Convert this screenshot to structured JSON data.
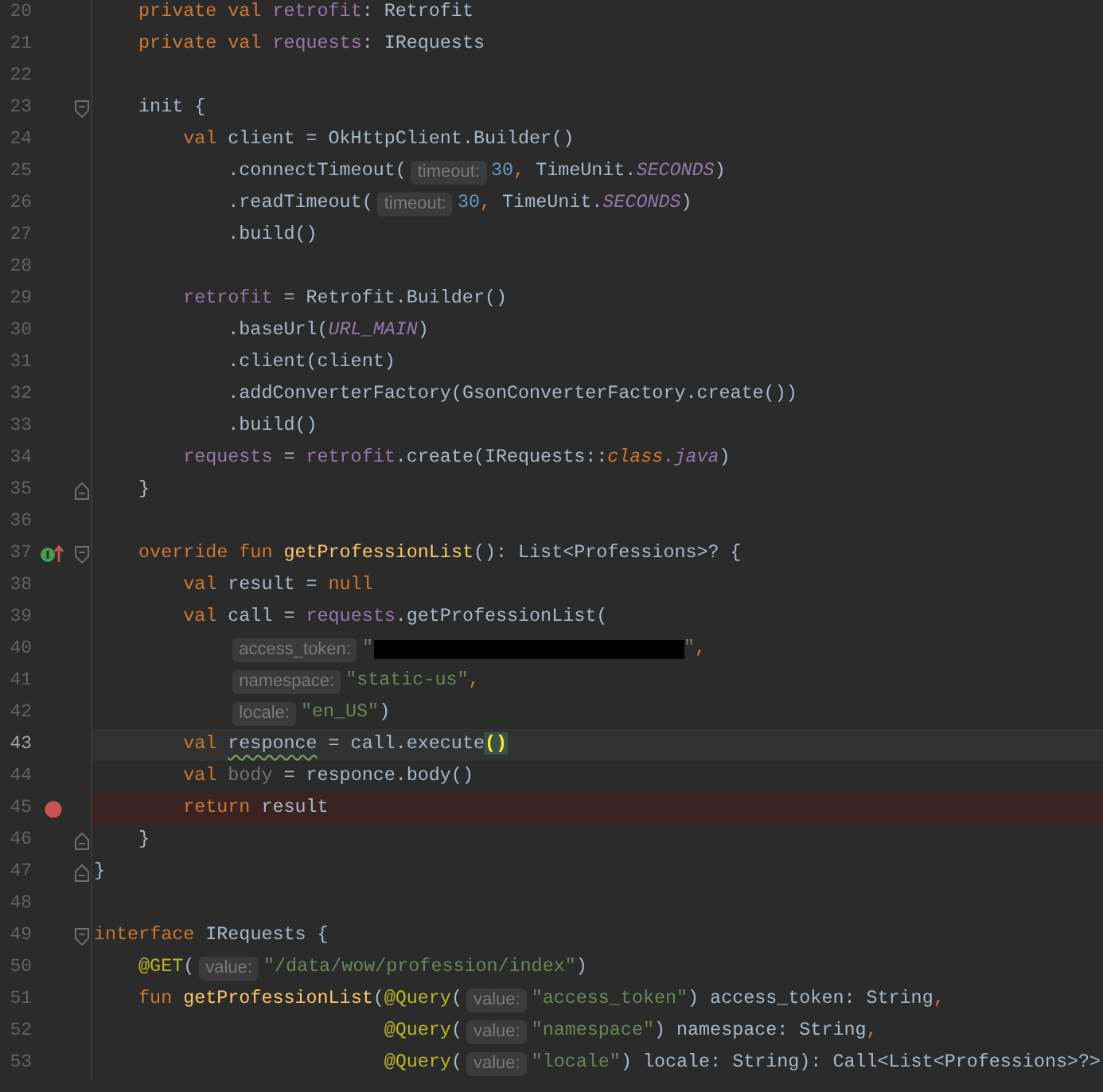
{
  "editor": {
    "class_body": [
      {
        "number": "20",
        "kind": "plain",
        "current": false,
        "breakpoint": false,
        "tokens": [
          {
            "text": "private val ",
            "kind": "kw"
          },
          {
            "text": "retrofit",
            "kind": "field"
          },
          {
            "text": ": Retrofit",
            "kind": "plain"
          }
        ]
      },
      {
        "number": "21",
        "kind": "plain",
        "current": false,
        "breakpoint": false,
        "tokens": [
          {
            "text": "private val ",
            "kind": "kw"
          },
          {
            "text": "requests",
            "kind": "field"
          },
          {
            "text": ": IRequests",
            "kind": "plain"
          }
        ]
      },
      {
        "number": "22",
        "kind": "plain",
        "current": false,
        "breakpoint": false
      },
      {
        "number": "23",
        "kind": "fold-start",
        "current": false,
        "breakpoint": false,
        "tokens": [
          {
            "text": "init {",
            "kind": "plain"
          }
        ],
        "children": [
          {
            "number": "24",
            "kind": "plain",
            "current": false,
            "breakpoint": false,
            "tokens": [
              {
                "text": "val ",
                "kind": "kw"
              },
              {
                "text": "client = OkHttpClient.Builder()",
                "kind": "plain"
              }
            ],
            "children": [
              {
                "number": "25",
                "kind": "plain",
                "current": false,
                "breakpoint": false,
                "tokens": [
                  {
                    "text": ".connectTimeout(",
                    "kind": "plain"
                  },
                  {
                    "text": "timeout:",
                    "kind": "hint"
                  },
                  {
                    "text": "30",
                    "kind": "num"
                  },
                  {
                    "text": ",",
                    "kind": "comma"
                  },
                  {
                    "text": " TimeUnit.",
                    "kind": "plain"
                  },
                  {
                    "text": "SECONDS",
                    "kind": "const"
                  },
                  {
                    "text": ")",
                    "kind": "plain"
                  }
                ]
              },
              {
                "number": "26",
                "kind": "plain",
                "current": false,
                "breakpoint": false,
                "tokens": [
                  {
                    "text": ".readTimeout(",
                    "kind": "plain"
                  },
                  {
                    "text": "timeout:",
                    "kind": "hint"
                  },
                  {
                    "text": "30",
                    "kind": "num"
                  },
                  {
                    "text": ",",
                    "kind": "comma"
                  },
                  {
                    "text": " TimeUnit.",
                    "kind": "plain"
                  },
                  {
                    "text": "SECONDS",
                    "kind": "const"
                  },
                  {
                    "text": ")",
                    "kind": "plain"
                  }
                ]
              },
              {
                "number": "27",
                "kind": "plain",
                "current": false,
                "breakpoint": false,
                "tokens": [
                  {
                    "text": ".build()",
                    "kind": "plain"
                  }
                ]
              }
            ]
          },
          {
            "number": "28",
            "kind": "plain",
            "current": false,
            "breakpoint": false
          },
          {
            "number": "29",
            "kind": "plain",
            "current": false,
            "breakpoint": false,
            "tokens": [
              {
                "text": "retrofit",
                "kind": "field"
              },
              {
                "text": " = Retrofit.Builder()",
                "kind": "plain"
              }
            ],
            "children": [
              {
                "number": "30",
                "kind": "plain",
                "current": false,
                "breakpoint": false,
                "tokens": [
                  {
                    "text": ".baseUrl(",
                    "kind": "plain"
                  },
                  {
                    "text": "URL_MAIN",
                    "kind": "const"
                  },
                  {
                    "text": ")",
                    "kind": "plain"
                  }
                ]
              },
              {
                "number": "31",
                "kind": "plain",
                "current": false,
                "breakpoint": false,
                "tokens": [
                  {
                    "text": ".client(client)",
                    "kind": "plain"
                  }
                ]
              },
              {
                "number": "32",
                "kind": "plain",
                "current": false,
                "breakpoint": false,
                "tokens": [
                  {
                    "text": ".addConverterFactory(GsonConverterFactory.create())",
                    "kind": "plain"
                  }
                ]
              },
              {
                "number": "33",
                "kind": "plain",
                "current": false,
                "breakpoint": false,
                "tokens": [
                  {
                    "text": ".build()",
                    "kind": "plain"
                  }
                ]
              }
            ]
          },
          {
            "number": "34",
            "kind": "plain",
            "current": false,
            "breakpoint": false,
            "tokens": [
              {
                "text": "requests",
                "kind": "field"
              },
              {
                "text": " = ",
                "kind": "plain"
              },
              {
                "text": "retrofit",
                "kind": "field"
              },
              {
                "text": ".create(IRequests::",
                "kind": "plain"
              },
              {
                "text": "class",
                "kind": "kwi"
              },
              {
                "text": ".java",
                "kind": "const"
              },
              {
                "text": ")",
                "kind": "plain"
              }
            ]
          }
        ]
      },
      {
        "number": "35",
        "kind": "fold-end",
        "current": false,
        "breakpoint": false,
        "tokens": [
          {
            "text": "}",
            "kind": "plain"
          }
        ]
      },
      {
        "number": "36",
        "kind": "plain",
        "current": false,
        "breakpoint": false
      },
      {
        "number": "37",
        "kind": "implements-fold-start",
        "current": false,
        "breakpoint": false,
        "tokens": [
          {
            "text": "override fun ",
            "kind": "kw"
          },
          {
            "text": "getProfessionList",
            "kind": "fn"
          },
          {
            "text": "(): List<Professions>? {",
            "kind": "plain"
          }
        ],
        "children": [
          {
            "number": "38",
            "kind": "plain",
            "current": false,
            "breakpoint": false,
            "tokens": [
              {
                "text": "val ",
                "kind": "kw"
              },
              {
                "text": "result = ",
                "kind": "plain"
              },
              {
                "text": "null",
                "kind": "kw"
              }
            ]
          },
          {
            "number": "39",
            "kind": "plain",
            "current": false,
            "breakpoint": false,
            "tokens": [
              {
                "text": "val ",
                "kind": "kw"
              },
              {
                "text": "call = ",
                "kind": "plain"
              },
              {
                "text": "requests",
                "kind": "field"
              },
              {
                "text": ".getProfessionList(",
                "kind": "plain"
              }
            ],
            "children": [
              {
                "number": "40",
                "kind": "plain",
                "current": false,
                "breakpoint": false,
                "tokens": [
                  {
                    "text": "access_token:",
                    "kind": "hint"
                  },
                  {
                    "text": "\"",
                    "kind": "str"
                  },
                  {
                    "kind": "redacted"
                  },
                  {
                    "text": "\"",
                    "kind": "str"
                  },
                  {
                    "text": ",",
                    "kind": "comma"
                  }
                ]
              },
              {
                "number": "41",
                "kind": "plain",
                "current": false,
                "breakpoint": false,
                "tokens": [
                  {
                    "text": "namespace:",
                    "kind": "hint"
                  },
                  {
                    "text": "\"static-us\"",
                    "kind": "str"
                  },
                  {
                    "text": ",",
                    "kind": "comma"
                  }
                ]
              },
              {
                "number": "42",
                "kind": "plain",
                "current": false,
                "breakpoint": false,
                "tokens": [
                  {
                    "text": "locale:",
                    "kind": "hint"
                  },
                  {
                    "text": "\"en_US\"",
                    "kind": "str"
                  },
                  {
                    "text": ")",
                    "kind": "plain"
                  }
                ]
              }
            ]
          },
          {
            "number": "43",
            "kind": "plain",
            "current": true,
            "breakpoint": false,
            "tokens": [
              {
                "text": "val ",
                "kind": "kw"
              },
              {
                "text": "responce",
                "kind": "typo"
              },
              {
                "text": " = call.execute",
                "kind": "plain"
              },
              {
                "text": "()",
                "kind": "match"
              }
            ]
          },
          {
            "number": "44",
            "kind": "plain",
            "current": false,
            "breakpoint": false,
            "tokens": [
              {
                "text": "val ",
                "kind": "kw"
              },
              {
                "text": "body",
                "kind": "unused"
              },
              {
                "text": " = responce.body()",
                "kind": "plain"
              }
            ]
          },
          {
            "number": "45",
            "kind": "plain",
            "current": false,
            "breakpoint": true,
            "tokens": [
              {
                "text": "return ",
                "kind": "kw"
              },
              {
                "text": "result",
                "kind": "plain"
              }
            ]
          }
        ]
      },
      {
        "number": "46",
        "kind": "fold-end",
        "current": false,
        "breakpoint": false,
        "tokens": [
          {
            "text": "}",
            "kind": "plain"
          }
        ]
      }
    ],
    "lines": [
      {
        "number": "47",
        "kind": "fold-end",
        "current": false,
        "breakpoint": false,
        "tokens": [
          {
            "text": "}",
            "kind": "plain"
          }
        ]
      },
      {
        "number": "48",
        "kind": "plain",
        "current": false,
        "breakpoint": false
      },
      {
        "number": "49",
        "kind": "fold-start",
        "current": false,
        "breakpoint": false,
        "tokens": [
          {
            "text": "interface ",
            "kind": "kw"
          },
          {
            "text": "IRequests {",
            "kind": "plain"
          }
        ],
        "children": [
          {
            "number": "50",
            "kind": "plain",
            "current": false,
            "breakpoint": false,
            "tokens": [
              {
                "text": "@GET",
                "kind": "annot"
              },
              {
                "text": "(",
                "kind": "plain"
              },
              {
                "text": "value:",
                "kind": "hint"
              },
              {
                "text": "\"/data/wow/profession/index\"",
                "kind": "str"
              },
              {
                "text": ")",
                "kind": "plain"
              }
            ]
          },
          {
            "number": "51",
            "kind": "plain",
            "current": false,
            "breakpoint": false,
            "tokens": [
              {
                "text": "fun ",
                "kind": "kw"
              },
              {
                "text": "getProfessionList",
                "kind": "fn"
              },
              {
                "text": "(",
                "kind": "plain"
              },
              {
                "text": "@Query",
                "kind": "annot"
              },
              {
                "text": "(",
                "kind": "plain"
              },
              {
                "text": "value:",
                "kind": "hint"
              },
              {
                "text": "\"access_token\"",
                "kind": "str"
              },
              {
                "text": ") access_token: String",
                "kind": "plain"
              },
              {
                "text": ",",
                "kind": "comma"
              }
            ],
            "children": [
              {
                "number": "52",
                "kind": "aligned",
                "current": false,
                "breakpoint": false,
                "tokens": [
                  {
                    "text": "@Query",
                    "kind": "annot"
                  },
                  {
                    "text": "(",
                    "kind": "plain"
                  },
                  {
                    "text": "value:",
                    "kind": "hint"
                  },
                  {
                    "text": "\"namespace\"",
                    "kind": "str"
                  },
                  {
                    "text": ") namespace: String",
                    "kind": "plain"
                  },
                  {
                    "text": ",",
                    "kind": "comma"
                  }
                ]
              },
              {
                "number": "53",
                "kind": "aligned",
                "current": false,
                "breakpoint": false,
                "tokens": [
                  {
                    "text": "@Query",
                    "kind": "annot"
                  },
                  {
                    "text": "(",
                    "kind": "plain"
                  },
                  {
                    "text": "value:",
                    "kind": "hint"
                  },
                  {
                    "text": "\"locale\"",
                    "kind": "str"
                  },
                  {
                    "text": ") locale: String): Call<List<Professions>?>",
                    "kind": "plain"
                  }
                ]
              }
            ]
          }
        ]
      }
    ]
  }
}
